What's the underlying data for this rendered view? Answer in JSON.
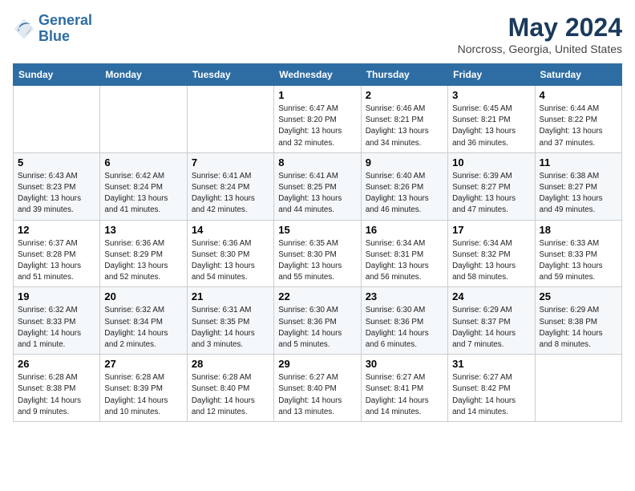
{
  "header": {
    "logo_line1": "General",
    "logo_line2": "Blue",
    "title": "May 2024",
    "subtitle": "Norcross, Georgia, United States"
  },
  "days_of_week": [
    "Sunday",
    "Monday",
    "Tuesday",
    "Wednesday",
    "Thursday",
    "Friday",
    "Saturday"
  ],
  "weeks": [
    {
      "days": [
        {
          "number": "",
          "info": ""
        },
        {
          "number": "",
          "info": ""
        },
        {
          "number": "",
          "info": ""
        },
        {
          "number": "1",
          "info": "Sunrise: 6:47 AM\nSunset: 8:20 PM\nDaylight: 13 hours and 32 minutes."
        },
        {
          "number": "2",
          "info": "Sunrise: 6:46 AM\nSunset: 8:21 PM\nDaylight: 13 hours and 34 minutes."
        },
        {
          "number": "3",
          "info": "Sunrise: 6:45 AM\nSunset: 8:21 PM\nDaylight: 13 hours and 36 minutes."
        },
        {
          "number": "4",
          "info": "Sunrise: 6:44 AM\nSunset: 8:22 PM\nDaylight: 13 hours and 37 minutes."
        }
      ]
    },
    {
      "days": [
        {
          "number": "5",
          "info": "Sunrise: 6:43 AM\nSunset: 8:23 PM\nDaylight: 13 hours and 39 minutes."
        },
        {
          "number": "6",
          "info": "Sunrise: 6:42 AM\nSunset: 8:24 PM\nDaylight: 13 hours and 41 minutes."
        },
        {
          "number": "7",
          "info": "Sunrise: 6:41 AM\nSunset: 8:24 PM\nDaylight: 13 hours and 42 minutes."
        },
        {
          "number": "8",
          "info": "Sunrise: 6:41 AM\nSunset: 8:25 PM\nDaylight: 13 hours and 44 minutes."
        },
        {
          "number": "9",
          "info": "Sunrise: 6:40 AM\nSunset: 8:26 PM\nDaylight: 13 hours and 46 minutes."
        },
        {
          "number": "10",
          "info": "Sunrise: 6:39 AM\nSunset: 8:27 PM\nDaylight: 13 hours and 47 minutes."
        },
        {
          "number": "11",
          "info": "Sunrise: 6:38 AM\nSunset: 8:27 PM\nDaylight: 13 hours and 49 minutes."
        }
      ]
    },
    {
      "days": [
        {
          "number": "12",
          "info": "Sunrise: 6:37 AM\nSunset: 8:28 PM\nDaylight: 13 hours and 51 minutes."
        },
        {
          "number": "13",
          "info": "Sunrise: 6:36 AM\nSunset: 8:29 PM\nDaylight: 13 hours and 52 minutes."
        },
        {
          "number": "14",
          "info": "Sunrise: 6:36 AM\nSunset: 8:30 PM\nDaylight: 13 hours and 54 minutes."
        },
        {
          "number": "15",
          "info": "Sunrise: 6:35 AM\nSunset: 8:30 PM\nDaylight: 13 hours and 55 minutes."
        },
        {
          "number": "16",
          "info": "Sunrise: 6:34 AM\nSunset: 8:31 PM\nDaylight: 13 hours and 56 minutes."
        },
        {
          "number": "17",
          "info": "Sunrise: 6:34 AM\nSunset: 8:32 PM\nDaylight: 13 hours and 58 minutes."
        },
        {
          "number": "18",
          "info": "Sunrise: 6:33 AM\nSunset: 8:33 PM\nDaylight: 13 hours and 59 minutes."
        }
      ]
    },
    {
      "days": [
        {
          "number": "19",
          "info": "Sunrise: 6:32 AM\nSunset: 8:33 PM\nDaylight: 14 hours and 1 minute."
        },
        {
          "number": "20",
          "info": "Sunrise: 6:32 AM\nSunset: 8:34 PM\nDaylight: 14 hours and 2 minutes."
        },
        {
          "number": "21",
          "info": "Sunrise: 6:31 AM\nSunset: 8:35 PM\nDaylight: 14 hours and 3 minutes."
        },
        {
          "number": "22",
          "info": "Sunrise: 6:30 AM\nSunset: 8:36 PM\nDaylight: 14 hours and 5 minutes."
        },
        {
          "number": "23",
          "info": "Sunrise: 6:30 AM\nSunset: 8:36 PM\nDaylight: 14 hours and 6 minutes."
        },
        {
          "number": "24",
          "info": "Sunrise: 6:29 AM\nSunset: 8:37 PM\nDaylight: 14 hours and 7 minutes."
        },
        {
          "number": "25",
          "info": "Sunrise: 6:29 AM\nSunset: 8:38 PM\nDaylight: 14 hours and 8 minutes."
        }
      ]
    },
    {
      "days": [
        {
          "number": "26",
          "info": "Sunrise: 6:28 AM\nSunset: 8:38 PM\nDaylight: 14 hours and 9 minutes."
        },
        {
          "number": "27",
          "info": "Sunrise: 6:28 AM\nSunset: 8:39 PM\nDaylight: 14 hours and 10 minutes."
        },
        {
          "number": "28",
          "info": "Sunrise: 6:28 AM\nSunset: 8:40 PM\nDaylight: 14 hours and 12 minutes."
        },
        {
          "number": "29",
          "info": "Sunrise: 6:27 AM\nSunset: 8:40 PM\nDaylight: 14 hours and 13 minutes."
        },
        {
          "number": "30",
          "info": "Sunrise: 6:27 AM\nSunset: 8:41 PM\nDaylight: 14 hours and 14 minutes."
        },
        {
          "number": "31",
          "info": "Sunrise: 6:27 AM\nSunset: 8:42 PM\nDaylight: 14 hours and 14 minutes."
        },
        {
          "number": "",
          "info": ""
        }
      ]
    }
  ]
}
